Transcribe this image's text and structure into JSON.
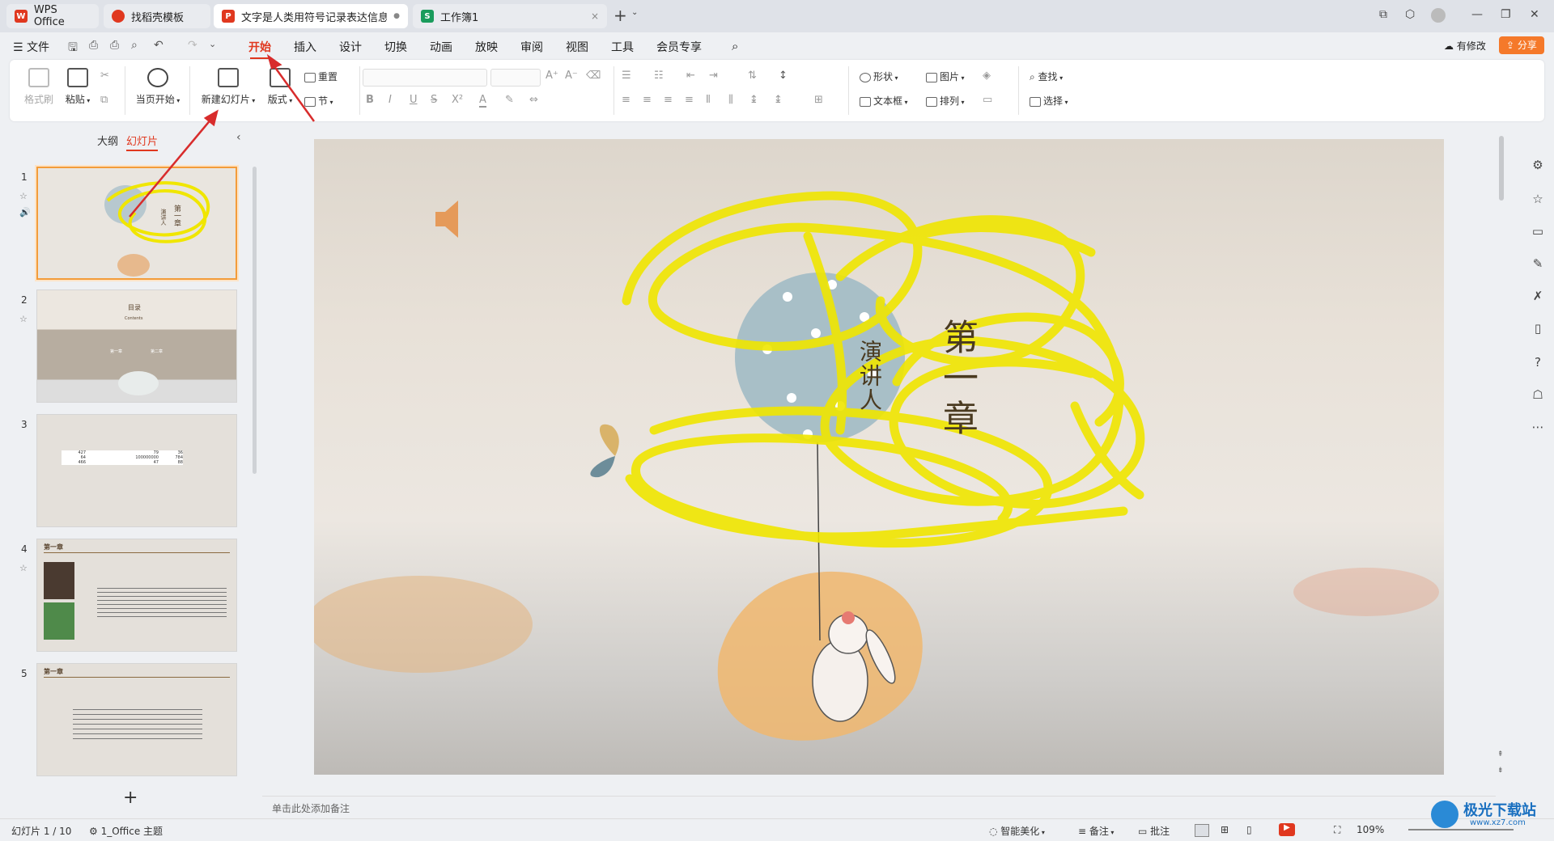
{
  "tabs": [
    {
      "label": "WPS Office",
      "icon": "wps-logo-icon"
    },
    {
      "label": "找稻壳模板",
      "icon": "docer-icon"
    },
    {
      "label": "文字是人类用符号记录表达信息以",
      "icon": "ppt-icon",
      "dot": "●"
    },
    {
      "label": "工作簿1",
      "icon": "sheet-icon",
      "close": "×"
    }
  ],
  "tab_icon_letters": {
    "ppt": "P",
    "sheet": "S",
    "wps": "W"
  },
  "new_tab": "+",
  "menu": {
    "file": "文件",
    "items": [
      "开始",
      "插入",
      "设计",
      "切换",
      "动画",
      "放映",
      "审阅",
      "视图",
      "工具",
      "会员专享"
    ],
    "active": "开始",
    "has_changes": "有修改",
    "share": "分享"
  },
  "ribbon": {
    "format_painter": "格式刷",
    "paste": "粘贴",
    "from_current": "当页开始",
    "new_slide": "新建幻灯片",
    "layout": "版式",
    "reset": "重置",
    "section": "节",
    "shape": "形状",
    "image": "图片",
    "textbox": "文本框",
    "arrange": "排列",
    "find": "查找",
    "select": "选择",
    "font_buttons": [
      "B",
      "I",
      "U",
      "S",
      "X²",
      "A"
    ]
  },
  "panel": {
    "outline_tab": "大纲",
    "slides_tab": "幻灯片",
    "add": "+",
    "slides": [
      {
        "num": "1",
        "texts": [
          "第一章",
          "演讲人"
        ]
      },
      {
        "num": "2",
        "texts": [
          "目录",
          "Contents",
          "第一章",
          "第二章"
        ]
      },
      {
        "num": "3",
        "table": [
          [
            "427",
            "79",
            "36"
          ],
          [
            "64",
            "100000000",
            "784"
          ],
          [
            "466",
            "47",
            "88"
          ]
        ]
      },
      {
        "num": "4",
        "heading": "第一章"
      },
      {
        "num": "5",
        "heading": "第一章"
      }
    ]
  },
  "slide": {
    "title": "第一章",
    "presenter": "演讲人"
  },
  "notes_placeholder": "单击此处添加备注",
  "status": {
    "slide_count": "幻灯片 1 / 10",
    "theme": "1_Office 主题",
    "beautify": "智能美化",
    "notes": "备注",
    "comments": "批注",
    "zoom": "109%"
  },
  "watermark": {
    "text": "极光下载站",
    "url": "www.xz7.com"
  },
  "colors": {
    "accent": "#e0381f",
    "share_bg": "#f5792a",
    "scribble": "#f0e600",
    "selection": "#f39c3a"
  }
}
